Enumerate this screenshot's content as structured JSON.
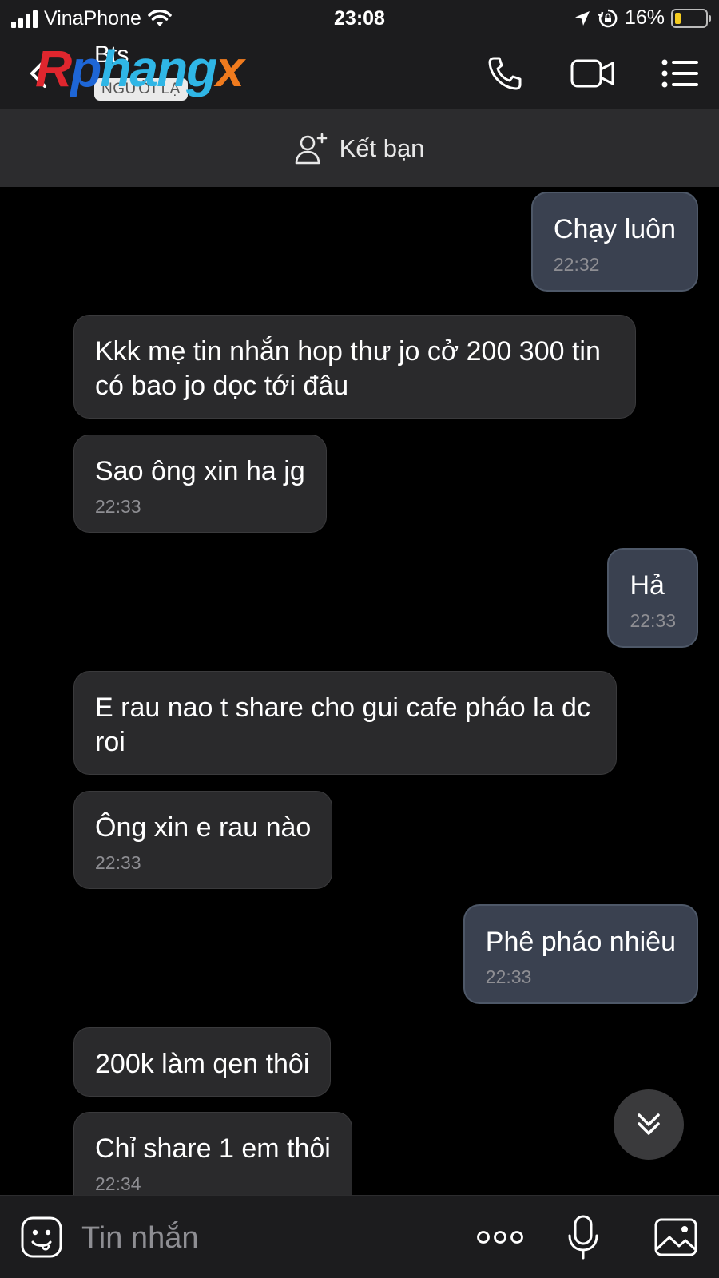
{
  "status_bar": {
    "carrier": "VinaPhone",
    "time": "23:08",
    "battery": "16%"
  },
  "header": {
    "contact_name": "Bts",
    "stranger_badge": "NGƯỜI LẠ",
    "watermark": {
      "part1": "R",
      "part2": "p",
      "part3": "hang",
      "part4": "x"
    }
  },
  "add_friend": {
    "label": "Kết bạn"
  },
  "messages": [
    {
      "side": "out",
      "text": "Chạy luôn",
      "time": "22:32"
    },
    {
      "side": "in",
      "text": "Kkk mẹ tin nhắn hop thư jo cở 200 300 tin có bao jo dọc tới đâu",
      "time": ""
    },
    {
      "side": "in",
      "text": "Sao ông xin ha jg",
      "time": "22:33"
    },
    {
      "side": "out",
      "text": "Hả",
      "time": "22:33"
    },
    {
      "side": "in",
      "text": "E rau nao t share cho gui cafe pháo la dc roi",
      "time": ""
    },
    {
      "side": "in",
      "text": "Ông xin e rau nào",
      "time": "22:33"
    },
    {
      "side": "out",
      "text": "Phê pháo nhiêu",
      "time": "22:33"
    },
    {
      "side": "in",
      "text": "200k làm qen thôi",
      "time": ""
    },
    {
      "side": "in",
      "text": "Chỉ share 1 em thôi",
      "time": "22:34"
    }
  ],
  "input_bar": {
    "placeholder": "Tin nhắn"
  },
  "colors": {
    "incoming_bubble": "#2a2a2c",
    "outgoing_bubble": "#3a4150",
    "background": "#000000"
  }
}
